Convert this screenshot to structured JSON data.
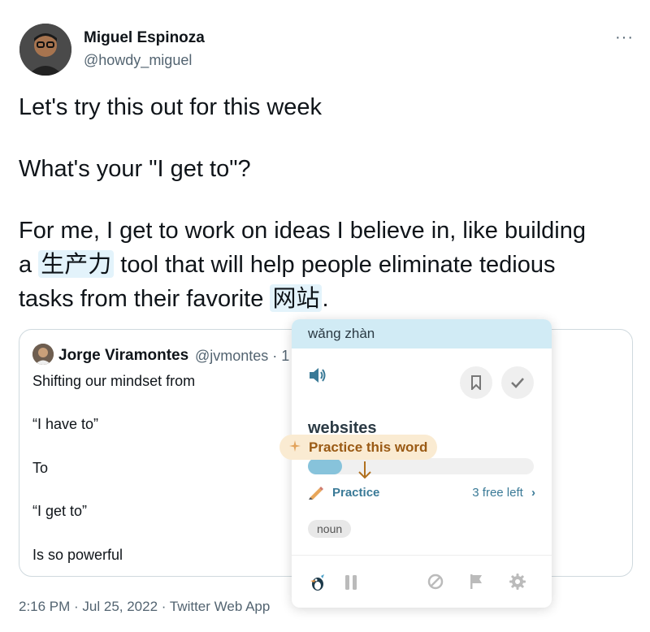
{
  "author": {
    "name": "Miguel Espinoza",
    "handle": "@howdy_miguel"
  },
  "tweet": {
    "line1": "Let's try this out for this week",
    "line2": "What's your \"I get to\"?",
    "line3a": "For me, I get to work on ideas I believe in, like building",
    "line3b_pre": "a ",
    "hl1": "生产力",
    "line3b_post": " tool that will help people eliminate tedious",
    "line3c_pre": "tasks from their favorite ",
    "hl2": "网站",
    "line3c_post": "."
  },
  "quote": {
    "name": "Jorge Viramontes",
    "handle": "@jvmontes · 1",
    "lines": [
      "Shifting our mindset from",
      "“I have to”",
      "To",
      "“I get to”",
      "Is so powerful"
    ]
  },
  "timestamp": "2:16 PM · Jul 25, 2022 · Twitter Web App",
  "popup": {
    "pinyin": "wǎng zhàn",
    "word": "websites",
    "callout": "Practice this word",
    "practice_label": "Practice",
    "free_left": "3 free left",
    "pos": "noun",
    "progress": 0.15
  },
  "colors": {
    "highlight": "#e3f3fb",
    "popup_header": "#d1ebf5",
    "accent": "#3a7a97",
    "callout_bg": "#faebd2",
    "callout_text": "#9a5a14"
  },
  "icons": [
    "more-icon",
    "speaker-icon",
    "bookmark-icon",
    "check-icon",
    "sparkle-icon",
    "arrow-down-icon",
    "pencil-icon",
    "chevron-right-icon",
    "bird-icon",
    "pause-icon",
    "block-icon",
    "flag-icon",
    "gear-icon"
  ]
}
